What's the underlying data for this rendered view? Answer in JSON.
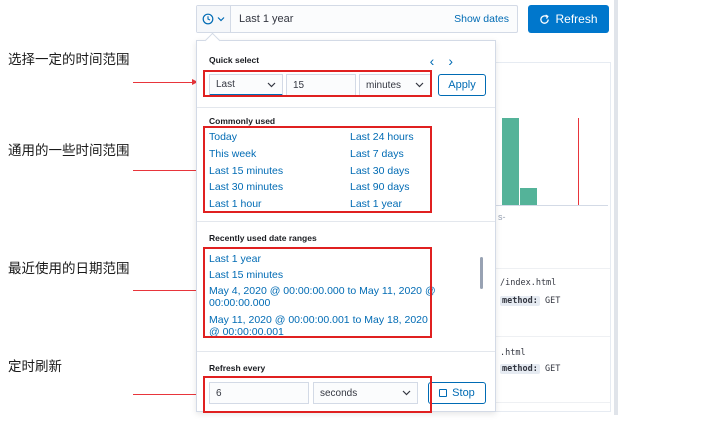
{
  "annotations": [
    "选择一定的时间范围",
    "通用的一些时间范围",
    "最近使用的日期范围",
    "定时刷新"
  ],
  "topbar": {
    "range_label": "Last 1 year",
    "show_dates": "Show dates",
    "refresh_label": "Refresh"
  },
  "background": {
    "doc1_path": "/index.html",
    "doc2_path": ".html",
    "method_key": "method:",
    "method_value": "GET"
  },
  "quick_select": {
    "title": "Quick select",
    "direction": "Last",
    "value": "15",
    "unit": "minutes",
    "apply": "Apply"
  },
  "commonly_used": {
    "title": "Commonly used",
    "left": [
      "Today",
      "This week",
      "Last 15 minutes",
      "Last 30 minutes",
      "Last 1 hour"
    ],
    "right": [
      "Last 24 hours",
      "Last 7 days",
      "Last 30 days",
      "Last 90 days",
      "Last 1 year"
    ]
  },
  "recently_used": {
    "title": "Recently used date ranges",
    "items": [
      "Last 1 year",
      "Last 15 minutes",
      "May 4, 2020 @ 00:00:00.000 to May 11, 2020 @ 00:00:00.000",
      "May 11, 2020 @ 00:00:00.001 to May 18, 2020 @ 00:00:00.001"
    ]
  },
  "refresh_every": {
    "title": "Refresh every",
    "value": "6",
    "unit": "seconds",
    "stop": "Stop"
  },
  "colors": {
    "link": "#006bb4",
    "primary": "#0077cc",
    "highlight": "#e02020",
    "bar": "#54b399"
  }
}
